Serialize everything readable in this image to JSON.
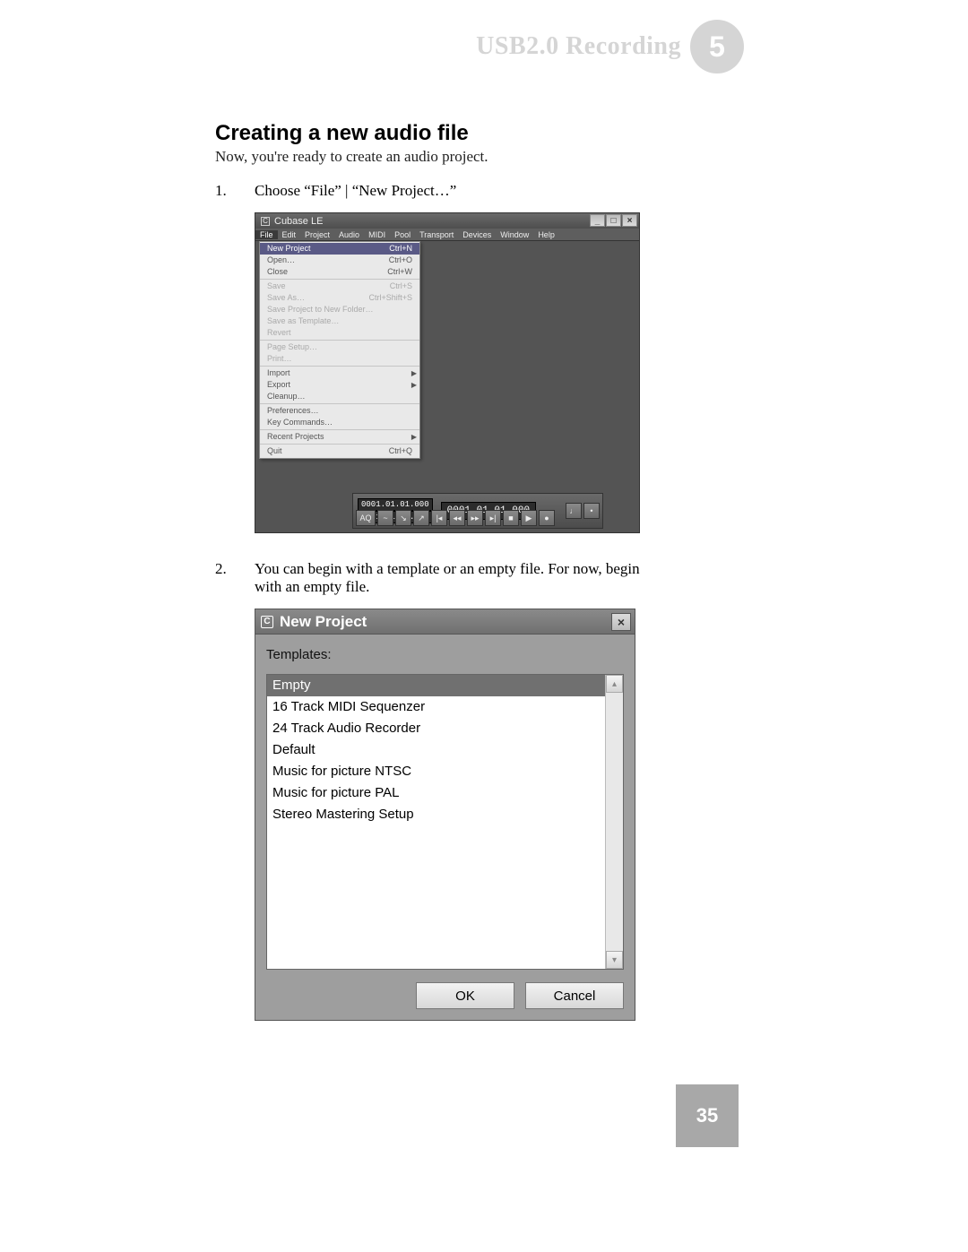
{
  "header": {
    "title": "USB2.0 Recording",
    "chapter": "5"
  },
  "section": {
    "heading": "Creating a new audio file",
    "intro": "Now, you're ready to create an audio project."
  },
  "steps": [
    {
      "num": "1.",
      "text": "Choose “File” | “New Project…”"
    },
    {
      "num": "2.",
      "text": "You can begin with a template or an empty file.  For now, begin with an empty file."
    }
  ],
  "cubase": {
    "title": "Cubase LE",
    "menubar": [
      "File",
      "Edit",
      "Project",
      "Audio",
      "MIDI",
      "Pool",
      "Transport",
      "Devices",
      "Window",
      "Help"
    ],
    "file_menu": [
      [
        {
          "label": "New Project",
          "shortcut": "Ctrl+N",
          "highlight": true
        },
        {
          "label": "Open…",
          "shortcut": "Ctrl+O"
        },
        {
          "label": "Close",
          "shortcut": "Ctrl+W"
        }
      ],
      [
        {
          "label": "Save",
          "shortcut": "Ctrl+S",
          "disabled": true
        },
        {
          "label": "Save As…",
          "shortcut": "Ctrl+Shift+S",
          "disabled": true
        },
        {
          "label": "Save Project to New Folder…",
          "disabled": true
        },
        {
          "label": "Save as Template…",
          "disabled": true
        },
        {
          "label": "Revert",
          "disabled": true
        }
      ],
      [
        {
          "label": "Page Setup…",
          "disabled": true
        },
        {
          "label": "Print…",
          "disabled": true
        }
      ],
      [
        {
          "label": "Import",
          "submenu": true
        },
        {
          "label": "Export",
          "submenu": true
        },
        {
          "label": "Cleanup…"
        }
      ],
      [
        {
          "label": "Preferences…"
        },
        {
          "label": "Key Commands…"
        }
      ],
      [
        {
          "label": "Recent Projects",
          "submenu": true
        }
      ],
      [
        {
          "label": "Quit",
          "shortcut": "Ctrl+Q"
        }
      ]
    ],
    "transport": {
      "pos1": "0001.01.01.000",
      "pos2": "0001.01.01.000",
      "big": "0001.01.01.000"
    }
  },
  "newproj": {
    "title": "New Project",
    "templates_label": "Templates:",
    "templates": [
      {
        "label": "Empty",
        "selected": true
      },
      {
        "label": "16 Track MIDI Sequenzer"
      },
      {
        "label": "24 Track Audio Recorder"
      },
      {
        "label": "Default"
      },
      {
        "label": "Music for picture NTSC"
      },
      {
        "label": "Music for picture PAL"
      },
      {
        "label": "Stereo Mastering Setup"
      }
    ],
    "ok": "OK",
    "cancel": "Cancel"
  },
  "page_number": "35"
}
